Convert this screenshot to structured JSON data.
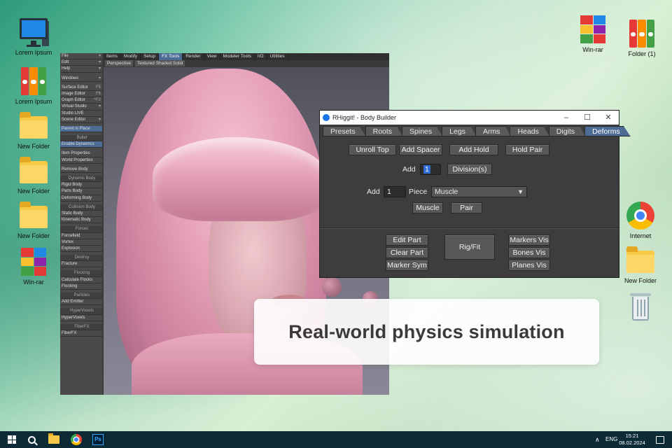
{
  "desktop": {
    "left_icons": [
      {
        "label": "Lorem Ipsum",
        "icon": "computer-icon"
      },
      {
        "label": "Lorem Ipsum",
        "icon": "binders-icon"
      },
      {
        "label": "New Folder",
        "icon": "folder-icon"
      },
      {
        "label": "New Folder",
        "icon": "folder-icon"
      },
      {
        "label": "New Folder",
        "icon": "folder-icon"
      },
      {
        "label": "Win-rar",
        "icon": "winrar-icon"
      }
    ],
    "right_icons": [
      {
        "label": "Win-rar",
        "icon": "winrar-icon"
      },
      {
        "label": "Folder (1)",
        "icon": "binders-icon"
      },
      {
        "label": "Internet",
        "icon": "chrome-icon"
      },
      {
        "label": "New Folder",
        "icon": "folder-icon"
      },
      {
        "label": "",
        "icon": "recycle-bin-icon"
      }
    ]
  },
  "lightwave": {
    "sidebar": [
      {
        "label": "File",
        "type": "menu"
      },
      {
        "label": "Edit",
        "type": "menu"
      },
      {
        "label": "Help",
        "type": "menu"
      },
      {
        "label": "",
        "type": "gap"
      },
      {
        "label": "Windows",
        "type": "menu"
      },
      {
        "label": "",
        "type": "gap"
      },
      {
        "label": "Surface Editor",
        "key": "F5"
      },
      {
        "label": "Image Editor",
        "key": "F6"
      },
      {
        "label": "Graph Editor",
        "key": "^F2"
      },
      {
        "label": "Virtual Studio",
        "type": "menu"
      },
      {
        "label": "Studio LIVE"
      },
      {
        "label": "Scene Editor",
        "type": "menu"
      },
      {
        "label": "",
        "type": "gap"
      },
      {
        "label": "Parent in Place",
        "hl": true
      },
      {
        "label": "",
        "type": "gap"
      },
      {
        "label": "Bullet",
        "type": "hdr"
      },
      {
        "label": "Enable Dynamics",
        "hl": true
      },
      {
        "label": "",
        "type": "gap"
      },
      {
        "label": "Item Properties"
      },
      {
        "label": "World Properties"
      },
      {
        "label": "",
        "type": "gap"
      },
      {
        "label": "Remove Body"
      },
      {
        "label": "",
        "type": "gap"
      },
      {
        "label": "Dynamic Body",
        "type": "hdr"
      },
      {
        "label": "Rigid Body"
      },
      {
        "label": "Parts Body"
      },
      {
        "label": "Deforming Body"
      },
      {
        "label": "",
        "type": "gap"
      },
      {
        "label": "Collision Body",
        "type": "hdr"
      },
      {
        "label": "Static Body"
      },
      {
        "label": "Kinematic Body"
      },
      {
        "label": "",
        "type": "gap"
      },
      {
        "label": "Forces",
        "type": "hdr"
      },
      {
        "label": "Forcefield"
      },
      {
        "label": "Vortex"
      },
      {
        "label": "Explosion"
      },
      {
        "label": "",
        "type": "gap"
      },
      {
        "label": "Destroy",
        "type": "hdr"
      },
      {
        "label": "Fracture"
      },
      {
        "label": "",
        "type": "gap"
      },
      {
        "label": "Flocking",
        "type": "hdr"
      },
      {
        "label": "Calculate Flocks"
      },
      {
        "label": "Flocking"
      },
      {
        "label": "",
        "type": "gap"
      },
      {
        "label": "Particles",
        "type": "hdr"
      },
      {
        "label": "Add Emitter"
      },
      {
        "label": "",
        "type": "gap"
      },
      {
        "label": "HyperVoxels",
        "type": "hdr"
      },
      {
        "label": "HyperVoxels"
      },
      {
        "label": "",
        "type": "gap"
      },
      {
        "label": "FiberFX",
        "type": "hdr"
      },
      {
        "label": "FiberFX"
      }
    ],
    "tabs": [
      "Items",
      "Modify",
      "Setup",
      "FX Tools",
      "Render",
      "View",
      "Modeler Tools",
      "I/O",
      "Utilities"
    ],
    "active_tab": "FX Tools",
    "viewport": {
      "view": "Perspective",
      "mode": "Textured Shaded Solid"
    }
  },
  "rhiggit": {
    "title": "RHiggit! - Body Builder",
    "tabs": [
      "Presets",
      "Roots",
      "Spines",
      "Legs",
      "Arms",
      "Heads",
      "Digits",
      "Deforms"
    ],
    "active_tab": "Deforms",
    "buttons_row1": [
      "Unroll Top",
      "Add Spacer",
      "Add Hold",
      "Hold Pair"
    ],
    "add_label": "Add",
    "add_value": "1",
    "divisions_label": "Division(s)",
    "add2_label": "Add",
    "add2_value": "1",
    "piece_label": "Piece",
    "piece_value": "Muscle",
    "muscle_label": "Muscle",
    "pair_label": "Pair",
    "edit_part": "Edit Part",
    "clear_part": "Clear Part",
    "marker_sym": "Marker Sym",
    "rig_fit": "Rig/Fit",
    "markers_vis": "Markers Vis",
    "bones_vis": "Bones Vis",
    "planes_vis": "Planes Vis"
  },
  "caption": "Real-world physics simulation",
  "taskbar": {
    "lang": "ENG",
    "time": "15:21",
    "date": "08.02.2024",
    "ps_label": "Ps"
  }
}
